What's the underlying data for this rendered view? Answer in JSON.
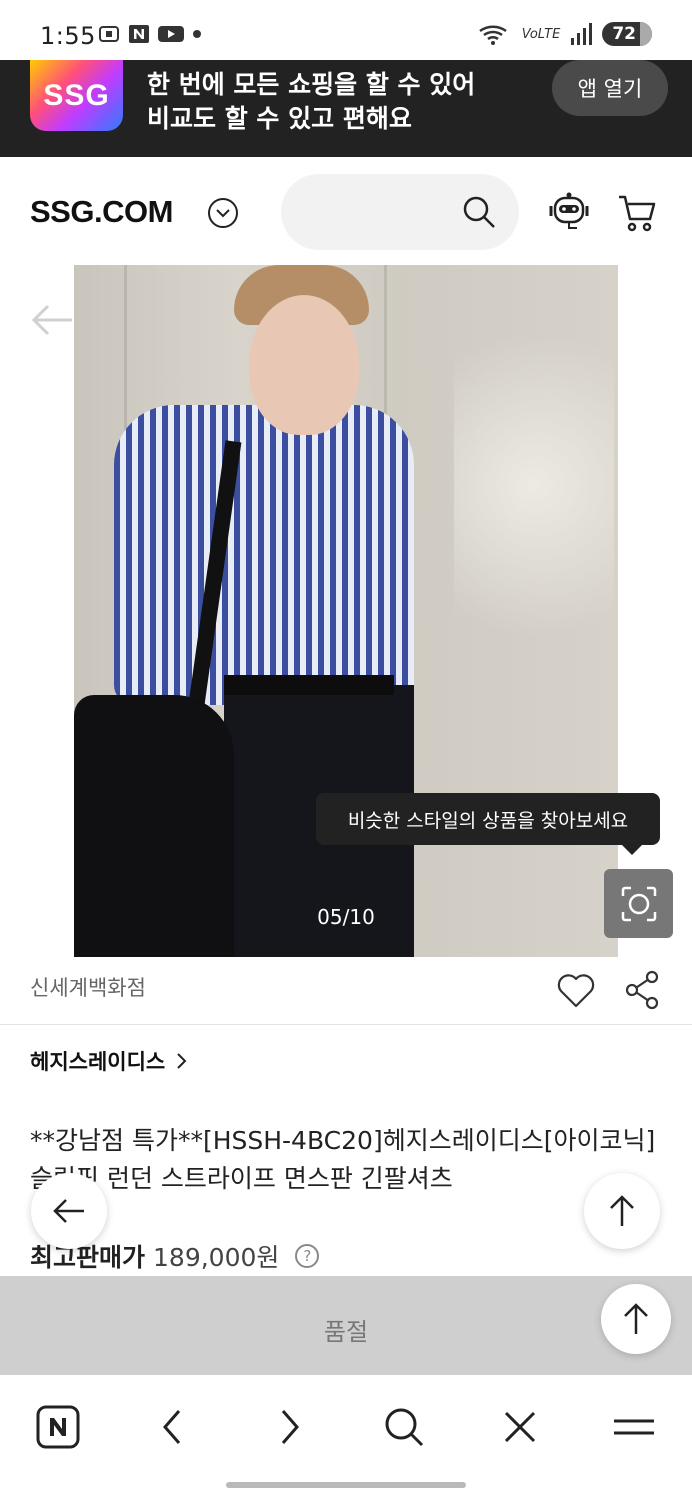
{
  "status_bar": {
    "time": "1:55",
    "network": "VoLTE",
    "battery": "72",
    "icons": [
      "screenshot-icon",
      "naver-icon",
      "youtube-icon",
      "dot-icon",
      "wifi-icon",
      "signal-icon",
      "battery-icon"
    ]
  },
  "app_banner": {
    "logo_text": "SSG",
    "line1": "한 번에 모든 쇼핑을 할 수 있어",
    "line2": "비교도 할 수 있고 편해요",
    "open_button": "앱 열기"
  },
  "header": {
    "logo": "SSG.COM",
    "search_placeholder": ""
  },
  "product": {
    "image_counter": "05/10",
    "tooltip": "비슷한 스타일의 상품을 찾아보세요",
    "seller": "신세계백화점",
    "brand": "헤지스레이디스",
    "title": "**강남점 특가**[HSSH-4BC20]헤지스레이디스[아이코닉]슬림핏 런던 스트라이프 면스판 긴팔셔츠",
    "price_label": "최고판매가",
    "price_value": "189,000원",
    "help_symbol": "?"
  },
  "soldout": {
    "label": "품절"
  },
  "browser_nav": {
    "items": [
      "naver-home-icon",
      "back-icon",
      "forward-icon",
      "search-icon",
      "close-icon",
      "menu-icon"
    ]
  },
  "colors": {
    "banner_bg": "#222222",
    "soldout_bg": "#cfcfcf",
    "tooltip_bg": "#222222"
  }
}
